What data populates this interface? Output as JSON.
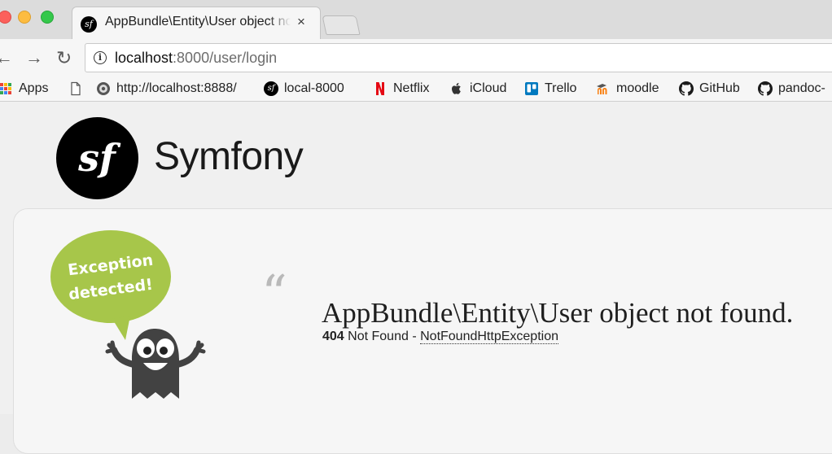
{
  "browser": {
    "tab": {
      "title": "AppBundle\\Entity\\User object not found.",
      "favicon": "symfony-icon",
      "close_glyph": "×"
    },
    "nav": {
      "back_glyph": "←",
      "forward_glyph": "→",
      "reload_glyph": "↻"
    },
    "address": {
      "host": "localhost",
      "rest": ":8000/user/login"
    },
    "bookmarks": [
      {
        "label": "Apps",
        "icon": "apps-grid-icon"
      },
      {
        "label": "",
        "icon": "document-icon"
      },
      {
        "label": "http://localhost:8888/",
        "icon": "localhost-icon"
      },
      {
        "label": "local-8000",
        "icon": "symfony-icon"
      },
      {
        "label": "Netflix",
        "icon": "netflix-icon"
      },
      {
        "label": "iCloud",
        "icon": "apple-icon"
      },
      {
        "label": "Trello",
        "icon": "trello-icon"
      },
      {
        "label": "moodle",
        "icon": "moodle-icon"
      },
      {
        "label": "GitHub",
        "icon": "github-icon"
      },
      {
        "label": "pandoc-",
        "icon": "github-icon"
      }
    ]
  },
  "page": {
    "brand": {
      "name": "Symfony",
      "logo_text": "sf"
    },
    "mascot": {
      "speech_line1": "Exception",
      "speech_line2": "detected!"
    },
    "exception": {
      "quote": "“",
      "message": "AppBundle\\Entity\\User object not found.",
      "status_code": "404",
      "status_text": "Not Found",
      "separator": "-",
      "class_name": "NotFoundHttpException"
    }
  },
  "colors": {
    "symfony_black": "#000000",
    "mascot_green": "#a7c64a",
    "mascot_body": "#424242",
    "netflix_red": "#e50914",
    "trello_blue": "#0079bf",
    "moodle_orange": "#f98012"
  }
}
